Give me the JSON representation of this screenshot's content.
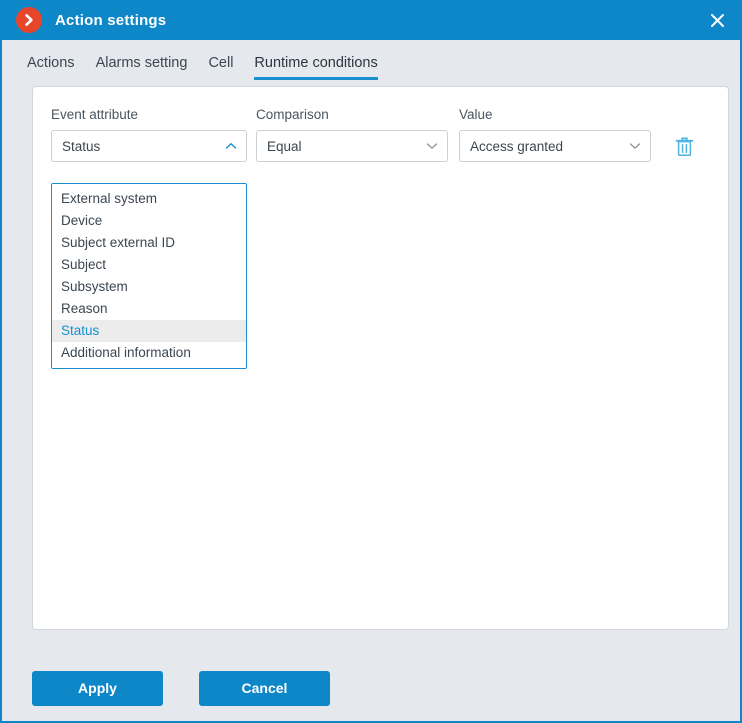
{
  "window": {
    "title": "Action settings",
    "app_icon": "chevron-right-circle-icon",
    "close_icon": "close-icon",
    "accent_color": "#0e87c9",
    "app_icon_color": "#e8462a",
    "background_color": "#e5e8ec"
  },
  "tabs": [
    {
      "label": "Actions",
      "active": false
    },
    {
      "label": "Alarms setting",
      "active": false
    },
    {
      "label": "Cell",
      "active": false
    },
    {
      "label": "Runtime conditions",
      "active": true
    }
  ],
  "condition_row": {
    "event_attribute": {
      "label": "Event attribute",
      "value": "Status",
      "expanded": true,
      "caret_icon": "chevron-up-icon",
      "options": [
        "External system",
        "Device",
        "Subject external ID",
        "Subject",
        "Subsystem",
        "Reason",
        "Status",
        "Additional information"
      ],
      "selected_option": "Status"
    },
    "comparison": {
      "label": "Comparison",
      "value": "Equal",
      "caret_icon": "chevron-down-icon"
    },
    "value": {
      "label": "Value",
      "value": "Access granted",
      "caret_icon": "chevron-down-icon"
    },
    "delete_icon": "trash-icon"
  },
  "footer": {
    "apply_label": "Apply",
    "cancel_label": "Cancel"
  }
}
